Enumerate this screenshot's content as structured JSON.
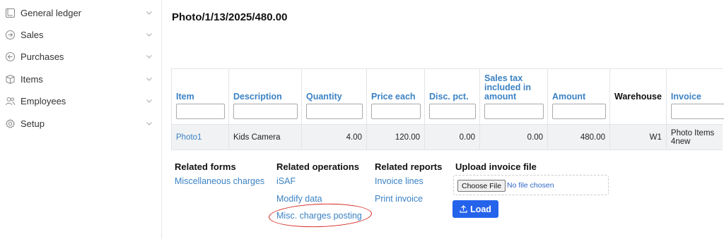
{
  "sidebar": {
    "items": [
      {
        "label": "General ledger",
        "icon": "ledger-icon"
      },
      {
        "label": "Sales",
        "icon": "arrow-right-circle-icon"
      },
      {
        "label": "Purchases",
        "icon": "arrow-left-circle-icon"
      },
      {
        "label": "Items",
        "icon": "box-icon"
      },
      {
        "label": "Employees",
        "icon": "users-icon"
      },
      {
        "label": "Setup",
        "icon": "gear-icon"
      }
    ]
  },
  "page": {
    "title": "Photo/1/13/2025/480.00"
  },
  "table": {
    "columns": [
      "Item",
      "Description",
      "Quantity",
      "Price each",
      "Disc. pct.",
      "Sales tax included in amount",
      "Amount",
      "Warehouse",
      "Invoice"
    ],
    "rows": [
      [
        "Photo1",
        "Kids Camera",
        "4.00",
        "120.00",
        "0.00",
        "0.00",
        "480.00",
        "W1",
        "Photo Items 4new"
      ]
    ]
  },
  "related_forms": {
    "heading": "Related forms",
    "links": [
      "Miscellaneous charges"
    ]
  },
  "related_operations": {
    "heading": "Related operations",
    "links": [
      "iSAF",
      "Modify data",
      "Misc. charges posting"
    ]
  },
  "related_reports": {
    "heading": "Related reports",
    "links": [
      "Invoice lines",
      "Print invoice"
    ]
  },
  "upload": {
    "heading": "Upload invoice file",
    "choose_label": "Choose File",
    "no_file_text": "No file chosen",
    "load_label": "Load"
  },
  "colors": {
    "link": "#3b82c4",
    "primary": "#2563eb",
    "annotation": "#d6271f"
  }
}
